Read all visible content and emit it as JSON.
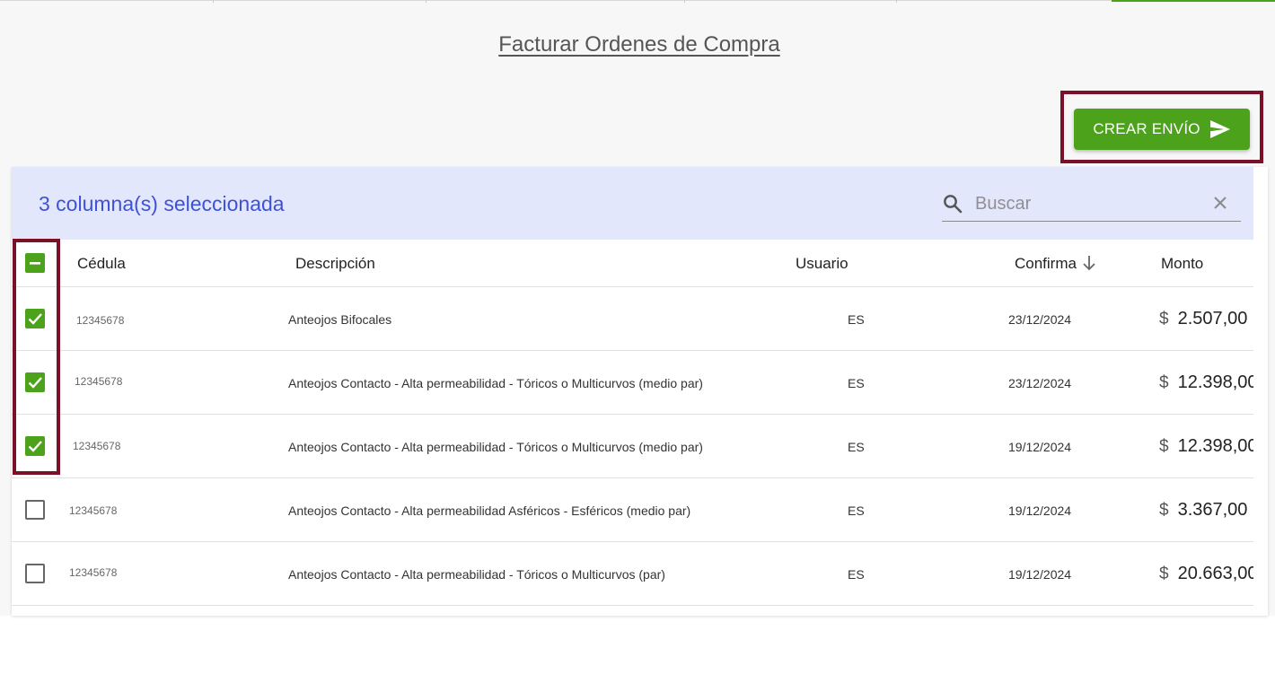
{
  "page": {
    "title": "Facturar Ordenes de Compra",
    "create_button_label": "CREAR ENVÍO",
    "accent_color": "#4ca21a",
    "highlight_color": "#7b1028"
  },
  "toolbar": {
    "selected_text": "3 columna(s) seleccionada",
    "search_placeholder": "Buscar",
    "search_value": ""
  },
  "columns": {
    "cedula": "Cédula",
    "descripcion": "Descripción",
    "usuario": "Usuario",
    "confirma": "Confirma",
    "monto": "Monto"
  },
  "sort": {
    "column": "Confirma",
    "direction": "descending"
  },
  "header_checkbox_state": "indeterminate",
  "rows": [
    {
      "checked": true,
      "cedula": "12345678",
      "descripcion": "Anteojos Bifocales",
      "usuario": "ES",
      "confirma": "23/12/2024",
      "currency": "$",
      "monto": "2.507,00"
    },
    {
      "checked": true,
      "cedula": "12345678",
      "descripcion": "Anteojos Contacto - Alta permeabilidad - Tóricos o Multicurvos (medio par)",
      "usuario": "ES",
      "confirma": "23/12/2024",
      "currency": "$",
      "monto": "12.398,00"
    },
    {
      "checked": true,
      "cedula": "12345678",
      "descripcion": "Anteojos Contacto - Alta permeabilidad - Tóricos o Multicurvos (medio par)",
      "usuario": "ES",
      "confirma": "19/12/2024",
      "currency": "$",
      "monto": "12.398,00"
    },
    {
      "checked": false,
      "cedula": "12345678",
      "descripcion": "Anteojos Contacto - Alta permeabilidad Asféricos - Esféricos (medio par)",
      "usuario": "ES",
      "confirma": "19/12/2024",
      "currency": "$",
      "monto": "3.367,00"
    },
    {
      "checked": false,
      "cedula": "12345678",
      "descripcion": "Anteojos Contacto - Alta permeabilidad - Tóricos o Multicurvos (par)",
      "usuario": "ES",
      "confirma": "19/12/2024",
      "currency": "$",
      "monto": "20.663,00"
    }
  ]
}
